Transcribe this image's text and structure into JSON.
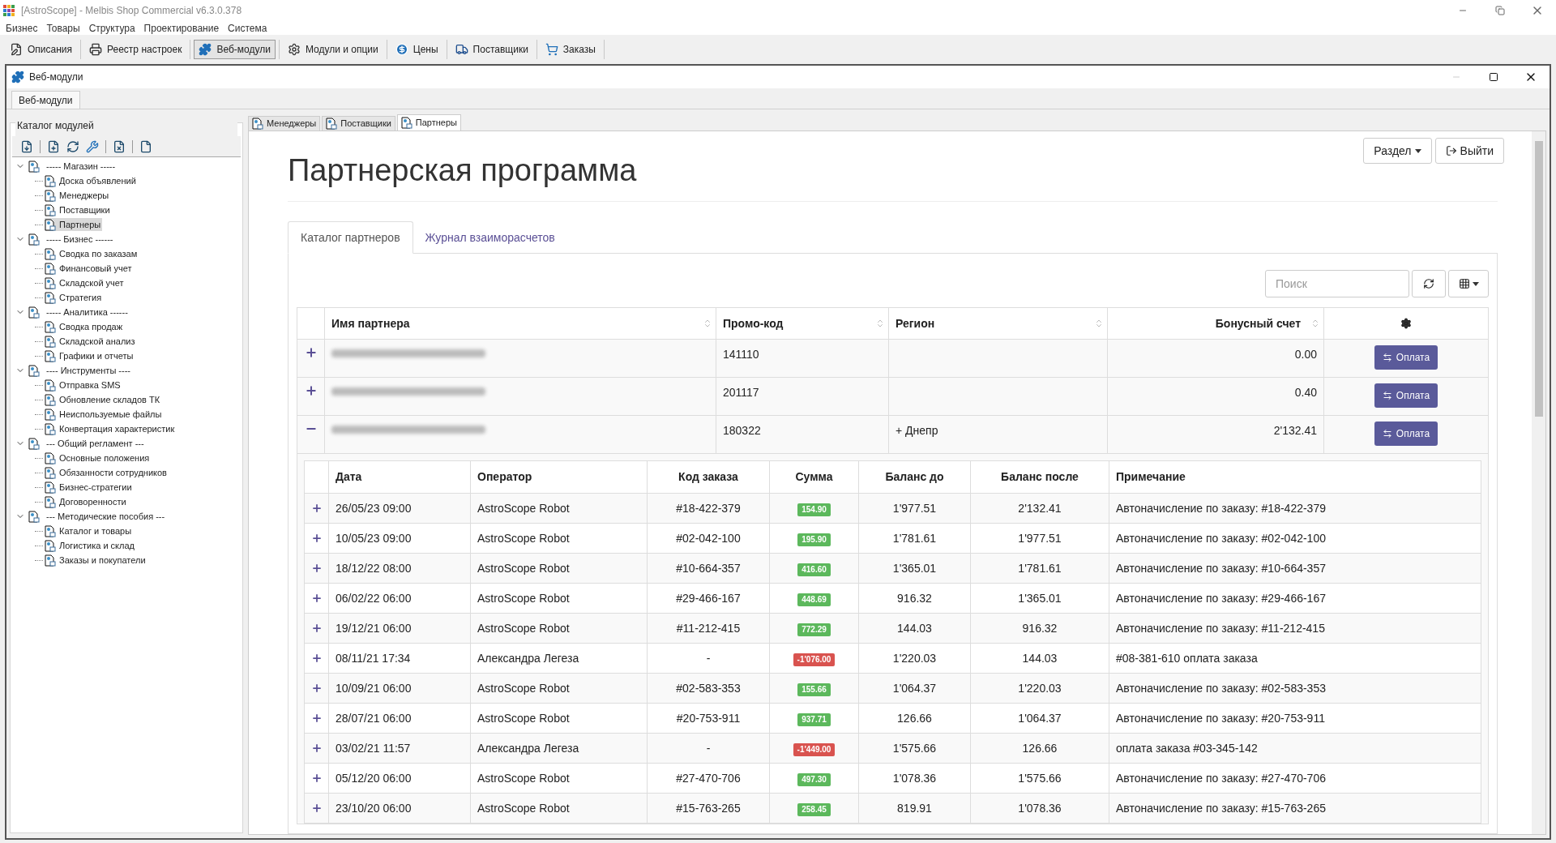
{
  "window": {
    "title": "[AstroScope] - Melbis Shop Commercial v6.3.0.378"
  },
  "menu": [
    "Бизнес",
    "Товары",
    "Структура",
    "Проектирование",
    "Система"
  ],
  "toolbar": [
    {
      "label": "Описания",
      "selected": false
    },
    {
      "label": "Реестр настроек",
      "selected": false
    },
    {
      "label": "Веб-модули",
      "selected": true
    },
    {
      "label": "Модули и опции",
      "selected": false
    },
    {
      "label": "Цены",
      "selected": false
    },
    {
      "label": "Поставщики",
      "selected": false
    },
    {
      "label": "Заказы",
      "selected": false
    }
  ],
  "inner_window": {
    "title": "Веб-модули",
    "tab": "Веб-модули"
  },
  "catalog": {
    "title": "Каталог модулей",
    "tree": [
      {
        "label": "----- Магазин -----",
        "expanded": true,
        "children": [
          {
            "label": "Доска объявлений",
            "selected": false
          },
          {
            "label": "Менеджеры",
            "selected": false
          },
          {
            "label": "Поставщики",
            "selected": false
          },
          {
            "label": "Партнеры",
            "selected": true
          }
        ]
      },
      {
        "label": "----- Бизнес ------",
        "expanded": true,
        "children": [
          {
            "label": "Сводка по заказам",
            "selected": false
          },
          {
            "label": "Финансовый учет",
            "selected": false
          },
          {
            "label": "Складской учет",
            "selected": false
          },
          {
            "label": "Стратегия",
            "selected": false
          }
        ]
      },
      {
        "label": "----- Аналитика ------",
        "expanded": true,
        "children": [
          {
            "label": "Сводка продаж",
            "selected": false
          },
          {
            "label": "Складской анализ",
            "selected": false
          },
          {
            "label": "Графики и отчеты",
            "selected": false
          }
        ]
      },
      {
        "label": "---- Инструменты ----",
        "expanded": true,
        "children": [
          {
            "label": "Отправка SMS",
            "selected": false
          },
          {
            "label": "Обновление складов ТК",
            "selected": false
          },
          {
            "label": "Неиспользуемые файлы",
            "selected": false
          },
          {
            "label": "Конвертация характеристик",
            "selected": false
          }
        ]
      },
      {
        "label": "--- Общий регламент ---",
        "expanded": true,
        "children": [
          {
            "label": "Основные положения",
            "selected": false
          },
          {
            "label": "Обязанности сотрудников",
            "selected": false
          },
          {
            "label": "Бизнес-стратегии",
            "selected": false
          },
          {
            "label": "Договоренности",
            "selected": false
          }
        ]
      },
      {
        "label": "--- Методические пособия ---",
        "expanded": true,
        "children": [
          {
            "label": "Каталог и товары",
            "selected": false
          },
          {
            "label": "Логистика и склад",
            "selected": false
          },
          {
            "label": "Заказы и покупатели",
            "selected": false
          }
        ]
      }
    ]
  },
  "module_tabs": [
    {
      "label": "Менеджеры",
      "selected": false
    },
    {
      "label": "Поставщики",
      "selected": false
    },
    {
      "label": "Партнеры",
      "selected": true
    }
  ],
  "page": {
    "title": "Партнерская программа",
    "section_button": "Раздел",
    "exit_button": "Выйти",
    "tabs": [
      {
        "label": "Каталог партнеров",
        "selected": true
      },
      {
        "label": "Журнал взаиморасчетов",
        "selected": false
      }
    ],
    "search": {
      "placeholder": "Поиск"
    },
    "partner_columns": [
      "Имя партнера",
      "Промо-код",
      "Регион",
      "Бонусный счет"
    ],
    "partners": [
      {
        "promo": "141110",
        "bonus": "0.00",
        "expanded": false,
        "action": "Оплата"
      },
      {
        "promo": "201117",
        "bonus": "0.40",
        "expanded": false,
        "action": "Оплата"
      },
      {
        "promo": "180322",
        "region": "+ Днепр",
        "bonus": "2'132.41",
        "expanded": true,
        "action": "Оплата"
      }
    ],
    "transaction_columns": [
      "Дата",
      "Оператор",
      "Код заказа",
      "Сумма",
      "Баланс до",
      "Баланс после",
      "Примечание"
    ],
    "transactions": [
      {
        "date": "26/05/23 09:00",
        "operator": "AstroScope Robot",
        "order": "#18-422-379",
        "amount": "154.90",
        "kind": "credit",
        "before": "1'977.51",
        "after": "2'132.41",
        "note": "Автоначисление по заказу: #18-422-379"
      },
      {
        "date": "10/05/23 09:00",
        "operator": "AstroScope Robot",
        "order": "#02-042-100",
        "amount": "195.90",
        "kind": "credit",
        "before": "1'781.61",
        "after": "1'977.51",
        "note": "Автоначисление по заказу: #02-042-100"
      },
      {
        "date": "18/12/22 08:00",
        "operator": "AstroScope Robot",
        "order": "#10-664-357",
        "amount": "416.60",
        "kind": "credit",
        "before": "1'365.01",
        "after": "1'781.61",
        "note": "Автоначисление по заказу: #10-664-357"
      },
      {
        "date": "06/02/22 06:00",
        "operator": "AstroScope Robot",
        "order": "#29-466-167",
        "amount": "448.69",
        "kind": "credit",
        "before": "916.32",
        "after": "1'365.01",
        "note": "Автоначисление по заказу: #29-466-167"
      },
      {
        "date": "19/12/21 06:00",
        "operator": "AstroScope Robot",
        "order": "#11-212-415",
        "amount": "772.29",
        "kind": "credit",
        "before": "144.03",
        "after": "916.32",
        "note": "Автоначисление по заказу: #11-212-415"
      },
      {
        "date": "08/11/21 17:34",
        "operator": "Александра Легеза",
        "order": "-",
        "amount": "-1'076.00",
        "kind": "debit",
        "before": "1'220.03",
        "after": "144.03",
        "note": "#08-381-610 оплата заказа"
      },
      {
        "date": "10/09/21 06:00",
        "operator": "AstroScope Robot",
        "order": "#02-583-353",
        "amount": "155.66",
        "kind": "credit",
        "before": "1'064.37",
        "after": "1'220.03",
        "note": "Автоначисление по заказу: #02-583-353"
      },
      {
        "date": "28/07/21 06:00",
        "operator": "AstroScope Robot",
        "order": "#20-753-911",
        "amount": "937.71",
        "kind": "credit",
        "before": "126.66",
        "after": "1'064.37",
        "note": "Автоначисление по заказу: #20-753-911"
      },
      {
        "date": "03/02/21 11:57",
        "operator": "Александра Легеза",
        "order": "-",
        "amount": "-1'449.00",
        "kind": "debit",
        "before": "1'575.66",
        "after": "126.66",
        "note": "оплата заказа #03-345-142"
      },
      {
        "date": "05/12/20 06:00",
        "operator": "AstroScope Robot",
        "order": "#27-470-706",
        "amount": "497.30",
        "kind": "credit",
        "before": "1'078.36",
        "after": "1'575.66",
        "note": "Автоначисление по заказу: #27-470-706"
      },
      {
        "date": "23/10/20 06:00",
        "operator": "AstroScope Robot",
        "order": "#15-763-265",
        "amount": "258.45",
        "kind": "credit",
        "before": "819.91",
        "after": "1'078.36",
        "note": "Автоначисление по заказу: #15-763-265"
      }
    ]
  }
}
